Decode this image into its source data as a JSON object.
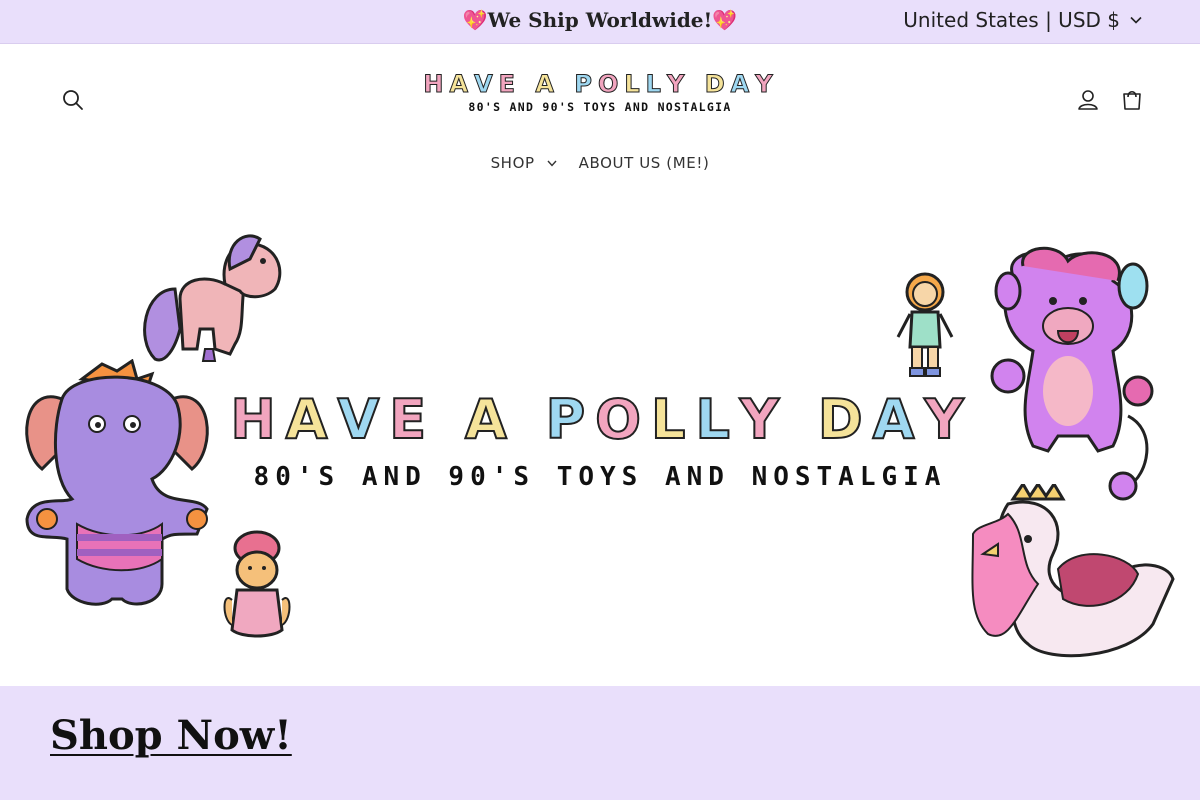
{
  "announcement": {
    "message": "💖We Ship Worldwide!💖"
  },
  "currency_selector": {
    "label": "United States | USD $"
  },
  "header": {
    "logo": {
      "title_letters": [
        {
          "ch": "H",
          "color": "#f2a5bf"
        },
        {
          "ch": "A",
          "color": "#f5e39a"
        },
        {
          "ch": "V",
          "color": "#9fd8f1"
        },
        {
          "ch": "E",
          "color": "#f2a5bf"
        },
        {
          "ch": " ",
          "color": "#ffffff"
        },
        {
          "ch": "A",
          "color": "#f5e39a"
        },
        {
          "ch": " ",
          "color": "#ffffff"
        },
        {
          "ch": "P",
          "color": "#9fd8f1"
        },
        {
          "ch": "O",
          "color": "#f2a5bf"
        },
        {
          "ch": "L",
          "color": "#f5e39a"
        },
        {
          "ch": "L",
          "color": "#9fd8f1"
        },
        {
          "ch": "Y",
          "color": "#f2a5bf"
        },
        {
          "ch": " ",
          "color": "#ffffff"
        },
        {
          "ch": "D",
          "color": "#f5e39a"
        },
        {
          "ch": "A",
          "color": "#9fd8f1"
        },
        {
          "ch": "Y",
          "color": "#f2a5bf"
        }
      ],
      "subtitle": "80'S AND 90'S TOYS AND NOSTALGIA"
    },
    "icons": {
      "search": "search-icon",
      "account": "account-icon",
      "cart": "cart-icon"
    },
    "nav": [
      {
        "label": "SHOP",
        "has_dropdown": true
      },
      {
        "label": "ABOUT US (ME!)",
        "has_dropdown": false
      }
    ]
  },
  "hero": {
    "title_letters": [
      {
        "ch": "H",
        "color": "#f2a5bf"
      },
      {
        "ch": "A",
        "color": "#f5e39a"
      },
      {
        "ch": "V",
        "color": "#9fd8f1"
      },
      {
        "ch": "E",
        "color": "#f2a5bf"
      },
      {
        "ch": " ",
        "color": "#ffffff"
      },
      {
        "ch": "A",
        "color": "#f5e39a"
      },
      {
        "ch": " ",
        "color": "#ffffff"
      },
      {
        "ch": "P",
        "color": "#9fd8f1"
      },
      {
        "ch": "O",
        "color": "#f2a5bf"
      },
      {
        "ch": "L",
        "color": "#f5e39a"
      },
      {
        "ch": "L",
        "color": "#9fd8f1"
      },
      {
        "ch": "Y",
        "color": "#f2a5bf"
      },
      {
        "ch": " ",
        "color": "#ffffff"
      },
      {
        "ch": "D",
        "color": "#f5e39a"
      },
      {
        "ch": "A",
        "color": "#9fd8f1"
      },
      {
        "ch": "Y",
        "color": "#f2a5bf"
      }
    ],
    "subtitle": "80'S AND 90'S TOYS AND NOSTALGIA",
    "illustrations": [
      "pony-illustration",
      "elephant-illustration",
      "doll-illustration",
      "girl-doll-illustration",
      "monkey-illustration",
      "swan-illustration"
    ]
  },
  "shop_section": {
    "link_label": "Shop Now!"
  },
  "colors": {
    "lavender": "#e9dffb",
    "pink": "#f2a5bf",
    "yellow": "#f5e39a",
    "blue": "#9fd8f1",
    "purple": "#b18fe0"
  }
}
